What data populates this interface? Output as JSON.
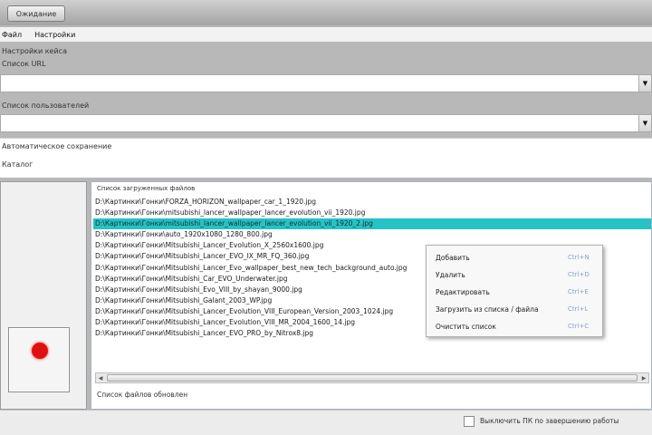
{
  "window": {
    "title": "Ожидание"
  },
  "menu": {
    "items": [
      "Файл",
      "Настройки"
    ]
  },
  "settings": {
    "section_label": "Настройки кейса",
    "sites_label": "Список URL",
    "sites_value": "",
    "users_label": "Список пользователей",
    "users_value": ""
  },
  "paths": {
    "auto_label": "Автоматическое сохранение",
    "folder_label": "Каталог"
  },
  "files": {
    "group_title": "Список загруженных файлов",
    "rows": [
      "D:\\Картинки\\Гонки\\FORZA_HORIZON_wallpaper_car_1_1920.jpg",
      "D:\\Картинки\\Гонки\\mitsubishi_lancer_wallpaper_lancer_evolution_vii_1920.jpg",
      "D:\\Картинки\\Гонки\\mitsubishi_lancer_wallpaper_lancer_evolution_vii_1920_2.jpg",
      "D:\\Картинки\\Гонки\\auto_1920x1080_1280_800.jpg",
      "D:\\Картинки\\Гонки\\Mitsubishi_Lancer_Evolution_X_2560x1600.jpg",
      "D:\\Картинки\\Гонки\\Mitsubishi_Lancer_EVO_IX_MR_FQ_360.jpg",
      "D:\\Картинки\\Гонки\\Mitsubishi_Lancer_Evo_wallpaper_best_new_tech_background_auto.jpg",
      "D:\\Картинки\\Гонки\\Mitsubishi_Car_EVO_Underwater.jpg",
      "D:\\Картинки\\Гонки\\Mitsubishi_Evo_VIII_by_shayan_9000.jpg",
      "D:\\Картинки\\Гонки\\Mitsubishi_Galant_2003_WP.jpg",
      "D:\\Картинки\\Гонки\\Mitsubishi_Lancer_Evolution_VIII_European_Version_2003_1024.jpg",
      "D:\\Картинки\\Гонки\\Mitsubishi_Lancer_Evolution_VIII_MR_2004_1600_14.jpg",
      "D:\\Картинки\\Гонки\\Mitsubishi_Lancer_EVO_PRO_by_Nitrox8.jpg"
    ],
    "selected_index": 2,
    "lock_label": "Список файлов обновлен"
  },
  "context_menu": {
    "items": [
      {
        "label": "Добавить",
        "shortcut": "Ctrl+N"
      },
      {
        "label": "Удалить",
        "shortcut": "Ctrl+D"
      },
      {
        "label": "Редактировать",
        "shortcut": "Ctrl+E"
      },
      {
        "label": "Загрузить из списка / файла",
        "shortcut": "Ctrl+L"
      },
      {
        "label": "Очистить список",
        "shortcut": "Ctrl+C"
      }
    ]
  },
  "status": {
    "checkbox_label": "Выключить ПК по завершению работы",
    "checked": false
  },
  "colors": {
    "selection": "#26c2c6",
    "record": "#e01010",
    "shortcut": "#8aa0c8"
  }
}
